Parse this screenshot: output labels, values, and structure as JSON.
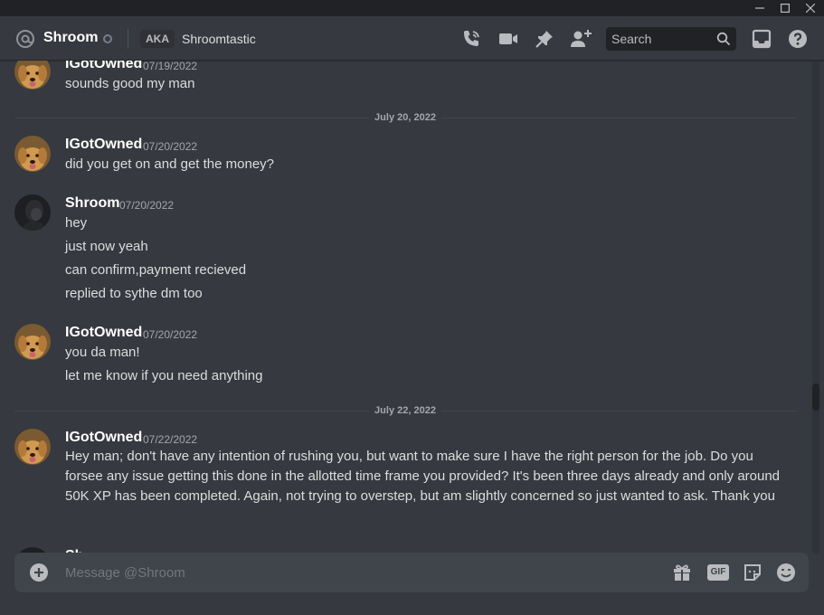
{
  "window": {
    "controls": [
      {
        "name": "minimize-icon"
      },
      {
        "name": "maximize-icon"
      },
      {
        "name": "close-icon"
      }
    ]
  },
  "header": {
    "icon": "at-sign-icon",
    "title": "Shroom",
    "aka_badge": "AKA",
    "alias": "Shroomtastic",
    "search_placeholder": "Search",
    "toolbar_icons": [
      "start-voice-call-icon",
      "start-video-call-icon",
      "pinned-messages-icon",
      "add-friends-to-dm-icon",
      "search-icon",
      "inbox-icon",
      "help-icon"
    ]
  },
  "messages": {
    "groups": [
      {
        "author": "IGotOwned",
        "timestamp": "07/19/2022",
        "lines": [
          "sounds good my man"
        ]
      },
      {
        "author": "IGotOwned",
        "timestamp": "07/20/2022",
        "lines": [
          "did you get on and get the money?"
        ]
      },
      {
        "author": "Shroom",
        "timestamp": "07/20/2022",
        "lines": [
          "hey",
          "just now yeah",
          "can confirm,payment recieved",
          "replied to sythe dm too"
        ]
      },
      {
        "author": "IGotOwned",
        "timestamp": "07/20/2022",
        "lines": [
          "you da man!",
          "let me know if you need anything"
        ]
      },
      {
        "author": "IGotOwned",
        "timestamp": "07/22/2022",
        "lines": [
          "Hey man; don't have any intention of rushing you, but want to make sure I have the right person for the job. Do you forsee any issue getting this done in the allotted time frame you provided? It's been three days already and only around 50K XP has been completed. Again, not trying to overstep, but am slightly concerned so just wanted to ask. Thank you"
        ]
      },
      {
        "author": "Sh",
        "timestamp": "",
        "lines": []
      }
    ],
    "dividers": [
      "July 20, 2022",
      "July 22, 2022"
    ]
  },
  "composer": {
    "placeholder": "Message @Shroom",
    "gif_label": "GIF",
    "icons": [
      "add-attachment-icon",
      "gift-icon",
      "gif-icon",
      "sticker-icon",
      "emoji-icon"
    ]
  },
  "colors": {
    "background": "#36393f",
    "titlebar": "#202225",
    "composer": "#40444b",
    "text": "#dcddde",
    "muted": "#a3a6aa"
  }
}
